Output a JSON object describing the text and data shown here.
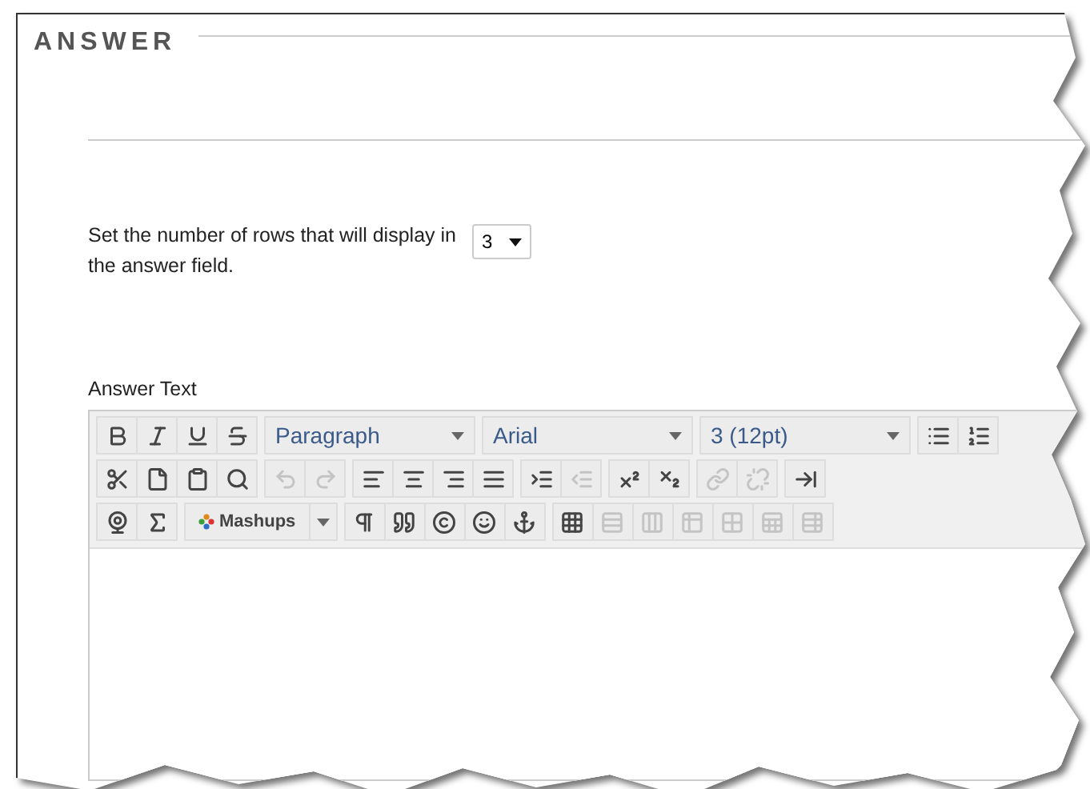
{
  "section": {
    "title": "ANSWER"
  },
  "rows_setting": {
    "label": "Set the number of rows that will display in the answer field.",
    "value": "3"
  },
  "editor": {
    "label": "Answer Text",
    "toolbar": [
      [
        [
          {
            "kind": "button",
            "disabled": false
          },
          {
            "kind": "button",
            "disabled": false
          },
          {
            "kind": "button",
            "disabled": false
          },
          {
            "kind": "button",
            "disabled": false
          }
        ],
        [
          {
            "kind": "dropdown",
            "value": "Paragraph"
          }
        ],
        [
          {
            "kind": "dropdown",
            "value": "Arial"
          }
        ],
        [
          {
            "kind": "dropdown",
            "value": "3 (12pt)"
          }
        ],
        [
          {
            "kind": "button",
            "disabled": false
          },
          {
            "kind": "button",
            "disabled": false
          }
        ]
      ],
      [
        [
          {
            "kind": "button",
            "disabled": false
          },
          {
            "kind": "button",
            "disabled": false
          },
          {
            "kind": "button",
            "disabled": false
          },
          {
            "kind": "button",
            "disabled": false
          }
        ],
        [
          {
            "kind": "button",
            "disabled": true
          },
          {
            "kind": "button",
            "disabled": true
          }
        ],
        [
          {
            "kind": "button",
            "disabled": false
          },
          {
            "kind": "button",
            "disabled": false
          },
          {
            "kind": "button",
            "disabled": false
          },
          {
            "kind": "button",
            "disabled": false
          }
        ],
        [
          {
            "kind": "button",
            "disabled": false
          },
          {
            "kind": "button",
            "disabled": true
          }
        ],
        [
          {
            "kind": "button",
            "disabled": false
          },
          {
            "kind": "button",
            "disabled": false
          }
        ],
        [
          {
            "kind": "button",
            "disabled": true
          },
          {
            "kind": "button",
            "disabled": true
          }
        ],
        [
          {
            "kind": "button",
            "disabled": false
          }
        ]
      ],
      [
        [
          {
            "kind": "button",
            "disabled": false
          },
          {
            "kind": "button",
            "disabled": false
          }
        ],
        [
          {
            "kind": "split",
            "value": "Mashups"
          }
        ],
        [
          {
            "kind": "button",
            "disabled": false
          },
          {
            "kind": "button",
            "disabled": false
          },
          {
            "kind": "button",
            "disabled": false
          },
          {
            "kind": "button",
            "disabled": false
          },
          {
            "kind": "button",
            "disabled": false
          }
        ],
        [
          {
            "kind": "button",
            "disabled": false
          },
          {
            "kind": "button",
            "disabled": true
          },
          {
            "kind": "button",
            "disabled": true
          },
          {
            "kind": "button",
            "disabled": true
          },
          {
            "kind": "button",
            "disabled": true
          },
          {
            "kind": "button",
            "disabled": true
          },
          {
            "kind": "button",
            "disabled": true
          }
        ]
      ]
    ]
  }
}
